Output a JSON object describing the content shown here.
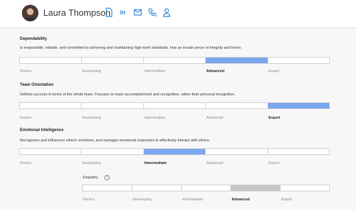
{
  "profile": {
    "name": "Laura Thompson",
    "icons": [
      "document-icon",
      "linkedin-icon",
      "email-icon",
      "phone-icon",
      "person-icon"
    ],
    "accent": "#2f7fd8"
  },
  "levels": [
    "Novice",
    "Developing",
    "Intermediate",
    "Advanced",
    "Expert"
  ],
  "competencies": [
    {
      "title": "Dependability",
      "description": "Is responsible, reliable, and committed to achieving and maintaining high work standards. Has an innate sense of integrity and honor.",
      "selected_level": "Advanced"
    },
    {
      "title": "Team Orientation",
      "description": "Defines success in terms of the whole team. Focuses on team accomplishment and recognition, rather than personal recognition.",
      "selected_level": "Expert"
    },
    {
      "title": "Emotional Intelligence",
      "description": "Recognizes and influences others' emotions, and manages emotional responses to effectively interact with others.",
      "selected_level": "Intermediate"
    }
  ],
  "sub_competency": {
    "title": "Empathy",
    "info_icon": "info-icon",
    "selected_level": "Advanced"
  },
  "colors": {
    "selected": "#7aa7ee",
    "selected_secondary": "#c8c8c8"
  }
}
